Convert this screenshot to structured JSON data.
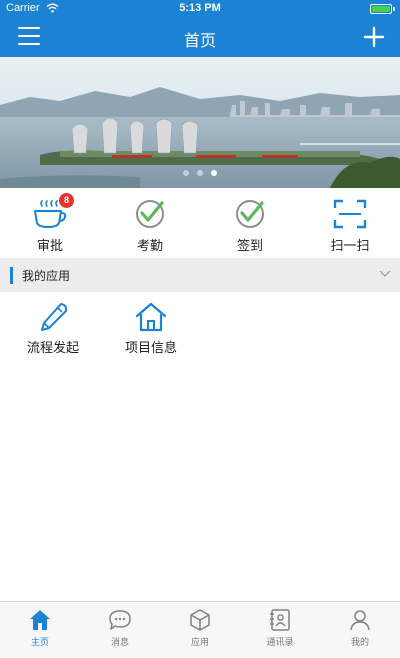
{
  "status_bar": {
    "carrier": "Carrier",
    "time": "5:13 PM"
  },
  "nav": {
    "title": "首页",
    "menu_icon": "menu-icon",
    "add_icon": "plus-icon"
  },
  "banner": {
    "image": "city-waterfront-photo",
    "page_count": 3,
    "active_page": 2
  },
  "quick_actions": [
    {
      "label": "审批",
      "icon": "coffee-cup-icon",
      "badge": "8"
    },
    {
      "label": "考勤",
      "icon": "check-circle-icon"
    },
    {
      "label": "签到",
      "icon": "check-circle-icon"
    },
    {
      "label": "扫一扫",
      "icon": "scan-icon"
    }
  ],
  "section": {
    "title": "我的应用",
    "chevron_icon": "chevron-down-icon"
  },
  "apps": [
    {
      "label": "流程发起",
      "icon": "pen-icon"
    },
    {
      "label": "项目信息",
      "icon": "house-icon"
    }
  ],
  "tabs": [
    {
      "label": "主页",
      "icon": "home-icon",
      "active": true
    },
    {
      "label": "消息",
      "icon": "chat-icon",
      "active": false
    },
    {
      "label": "应用",
      "icon": "cube-icon",
      "active": false
    },
    {
      "label": "通讯录",
      "icon": "contacts-icon",
      "active": false
    },
    {
      "label": "我的",
      "icon": "user-icon",
      "active": false
    }
  ],
  "colors": {
    "primary": "#1b82d4",
    "badge": "#e8312f",
    "check": "#5cb85c",
    "battery": "#41d45a"
  }
}
